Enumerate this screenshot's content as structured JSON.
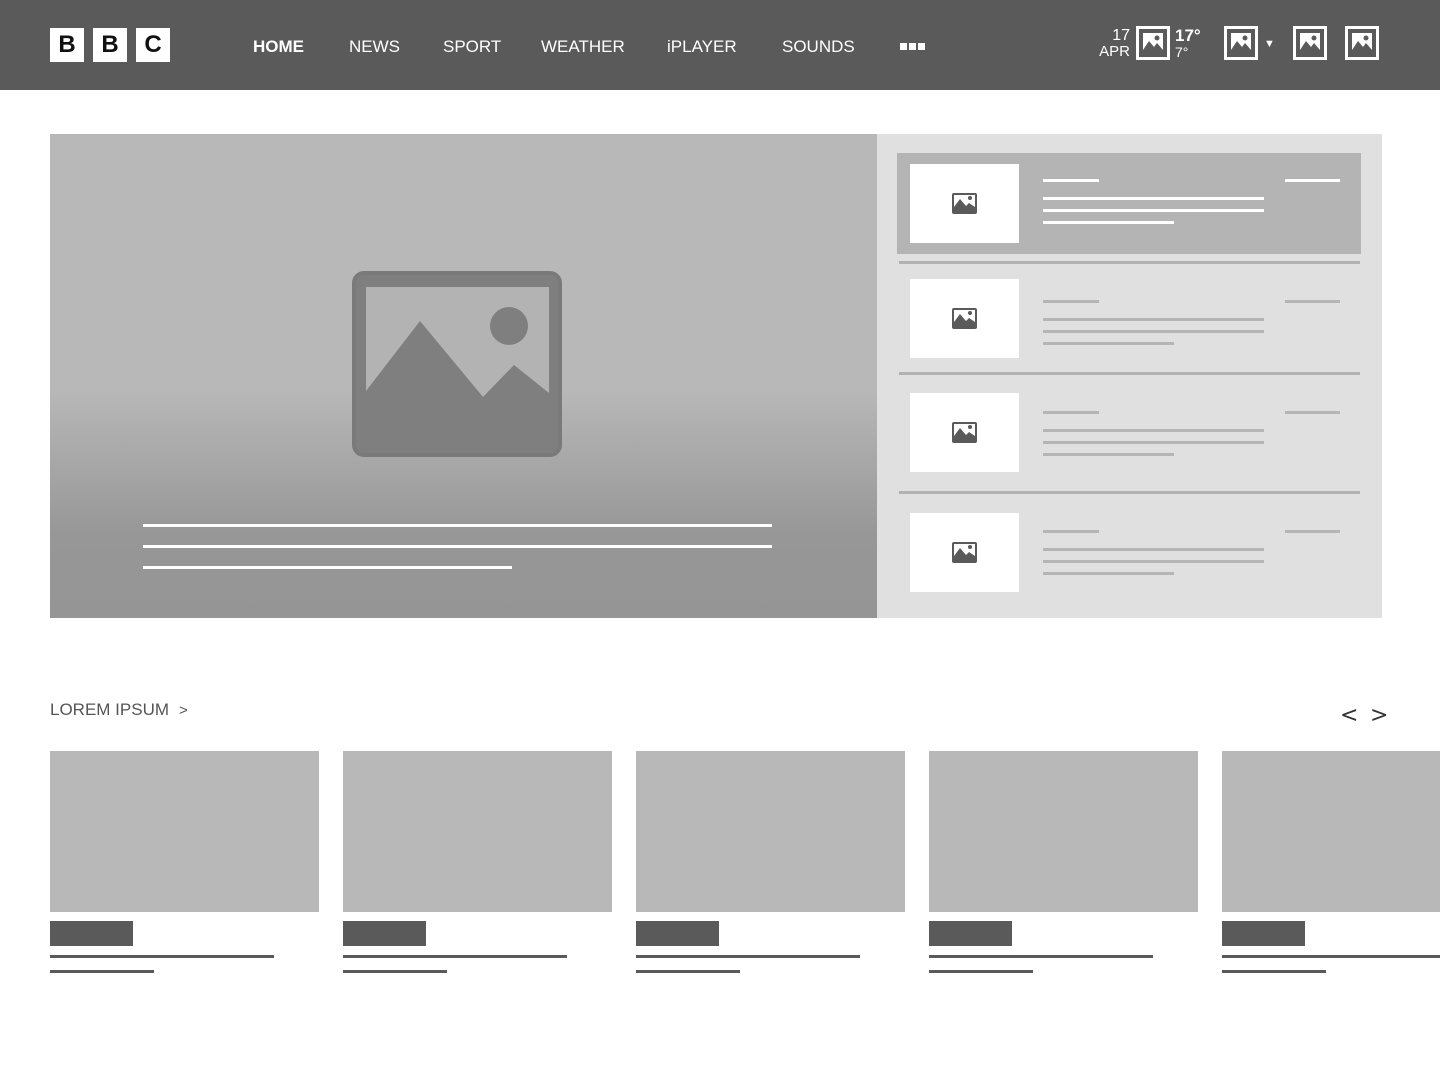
{
  "header": {
    "logo_letters": [
      "B",
      "B",
      "C"
    ],
    "nav": [
      {
        "label": "HOME"
      },
      {
        "label": "NEWS"
      },
      {
        "label": "SPORT"
      },
      {
        "label": "WEATHER"
      },
      {
        "label": "iPLAYER"
      },
      {
        "label": "SOUNDS"
      }
    ],
    "date": {
      "day": "17",
      "month": "APR"
    },
    "weather": {
      "high": "17°",
      "low": "7°"
    },
    "icons": [
      "weather-image-icon",
      "account-image-icon",
      "notifications-image-icon",
      "menu-image-icon"
    ]
  },
  "hero": {
    "image_icon": "image-placeholder-icon",
    "side_stories": [
      {
        "selected": true
      },
      {
        "selected": false
      },
      {
        "selected": false
      },
      {
        "selected": false
      }
    ]
  },
  "section": {
    "title": "LOREM IPSUM",
    "title_chevron": ">",
    "prev_label": "<",
    "next_label": ">"
  },
  "colors": {
    "header_bg": "#5a5a5a",
    "placeholder": "#b8b8b8",
    "side_panel": "#e0e0e0",
    "selected_story": "#b4b4b4"
  }
}
